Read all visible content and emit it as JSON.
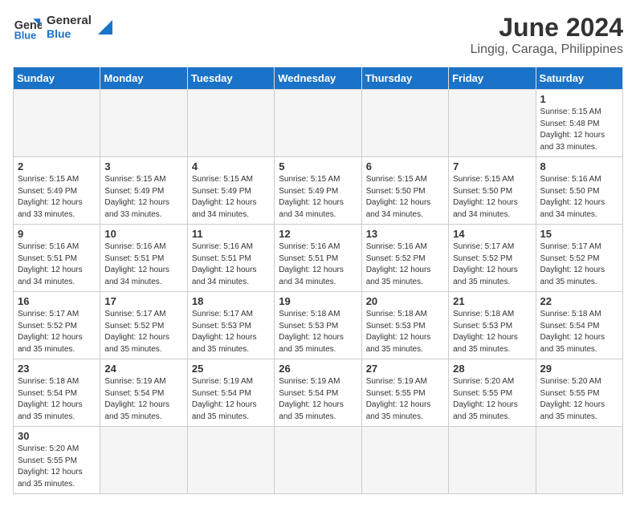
{
  "logo": {
    "line1": "General",
    "line2": "Blue"
  },
  "title": "June 2024",
  "subtitle": "Lingig, Caraga, Philippines",
  "days_header": [
    "Sunday",
    "Monday",
    "Tuesday",
    "Wednesday",
    "Thursday",
    "Friday",
    "Saturday"
  ],
  "weeks": [
    [
      {
        "day": "",
        "info": ""
      },
      {
        "day": "",
        "info": ""
      },
      {
        "day": "",
        "info": ""
      },
      {
        "day": "",
        "info": ""
      },
      {
        "day": "",
        "info": ""
      },
      {
        "day": "",
        "info": ""
      },
      {
        "day": "1",
        "info": "Sunrise: 5:15 AM\nSunset: 5:48 PM\nDaylight: 12 hours\nand 33 minutes."
      }
    ],
    [
      {
        "day": "2",
        "info": "Sunrise: 5:15 AM\nSunset: 5:49 PM\nDaylight: 12 hours\nand 33 minutes."
      },
      {
        "day": "3",
        "info": "Sunrise: 5:15 AM\nSunset: 5:49 PM\nDaylight: 12 hours\nand 33 minutes."
      },
      {
        "day": "4",
        "info": "Sunrise: 5:15 AM\nSunset: 5:49 PM\nDaylight: 12 hours\nand 34 minutes."
      },
      {
        "day": "5",
        "info": "Sunrise: 5:15 AM\nSunset: 5:49 PM\nDaylight: 12 hours\nand 34 minutes."
      },
      {
        "day": "6",
        "info": "Sunrise: 5:15 AM\nSunset: 5:50 PM\nDaylight: 12 hours\nand 34 minutes."
      },
      {
        "day": "7",
        "info": "Sunrise: 5:15 AM\nSunset: 5:50 PM\nDaylight: 12 hours\nand 34 minutes."
      },
      {
        "day": "8",
        "info": "Sunrise: 5:16 AM\nSunset: 5:50 PM\nDaylight: 12 hours\nand 34 minutes."
      }
    ],
    [
      {
        "day": "9",
        "info": "Sunrise: 5:16 AM\nSunset: 5:51 PM\nDaylight: 12 hours\nand 34 minutes."
      },
      {
        "day": "10",
        "info": "Sunrise: 5:16 AM\nSunset: 5:51 PM\nDaylight: 12 hours\nand 34 minutes."
      },
      {
        "day": "11",
        "info": "Sunrise: 5:16 AM\nSunset: 5:51 PM\nDaylight: 12 hours\nand 34 minutes."
      },
      {
        "day": "12",
        "info": "Sunrise: 5:16 AM\nSunset: 5:51 PM\nDaylight: 12 hours\nand 34 minutes."
      },
      {
        "day": "13",
        "info": "Sunrise: 5:16 AM\nSunset: 5:52 PM\nDaylight: 12 hours\nand 35 minutes."
      },
      {
        "day": "14",
        "info": "Sunrise: 5:17 AM\nSunset: 5:52 PM\nDaylight: 12 hours\nand 35 minutes."
      },
      {
        "day": "15",
        "info": "Sunrise: 5:17 AM\nSunset: 5:52 PM\nDaylight: 12 hours\nand 35 minutes."
      }
    ],
    [
      {
        "day": "16",
        "info": "Sunrise: 5:17 AM\nSunset: 5:52 PM\nDaylight: 12 hours\nand 35 minutes."
      },
      {
        "day": "17",
        "info": "Sunrise: 5:17 AM\nSunset: 5:52 PM\nDaylight: 12 hours\nand 35 minutes."
      },
      {
        "day": "18",
        "info": "Sunrise: 5:17 AM\nSunset: 5:53 PM\nDaylight: 12 hours\nand 35 minutes."
      },
      {
        "day": "19",
        "info": "Sunrise: 5:18 AM\nSunset: 5:53 PM\nDaylight: 12 hours\nand 35 minutes."
      },
      {
        "day": "20",
        "info": "Sunrise: 5:18 AM\nSunset: 5:53 PM\nDaylight: 12 hours\nand 35 minutes."
      },
      {
        "day": "21",
        "info": "Sunrise: 5:18 AM\nSunset: 5:53 PM\nDaylight: 12 hours\nand 35 minutes."
      },
      {
        "day": "22",
        "info": "Sunrise: 5:18 AM\nSunset: 5:54 PM\nDaylight: 12 hours\nand 35 minutes."
      }
    ],
    [
      {
        "day": "23",
        "info": "Sunrise: 5:18 AM\nSunset: 5:54 PM\nDaylight: 12 hours\nand 35 minutes."
      },
      {
        "day": "24",
        "info": "Sunrise: 5:19 AM\nSunset: 5:54 PM\nDaylight: 12 hours\nand 35 minutes."
      },
      {
        "day": "25",
        "info": "Sunrise: 5:19 AM\nSunset: 5:54 PM\nDaylight: 12 hours\nand 35 minutes."
      },
      {
        "day": "26",
        "info": "Sunrise: 5:19 AM\nSunset: 5:54 PM\nDaylight: 12 hours\nand 35 minutes."
      },
      {
        "day": "27",
        "info": "Sunrise: 5:19 AM\nSunset: 5:55 PM\nDaylight: 12 hours\nand 35 minutes."
      },
      {
        "day": "28",
        "info": "Sunrise: 5:20 AM\nSunset: 5:55 PM\nDaylight: 12 hours\nand 35 minutes."
      },
      {
        "day": "29",
        "info": "Sunrise: 5:20 AM\nSunset: 5:55 PM\nDaylight: 12 hours\nand 35 minutes."
      }
    ],
    [
      {
        "day": "30",
        "info": "Sunrise: 5:20 AM\nSunset: 5:55 PM\nDaylight: 12 hours\nand 35 minutes."
      },
      {
        "day": "",
        "info": ""
      },
      {
        "day": "",
        "info": ""
      },
      {
        "day": "",
        "info": ""
      },
      {
        "day": "",
        "info": ""
      },
      {
        "day": "",
        "info": ""
      },
      {
        "day": "",
        "info": ""
      }
    ]
  ]
}
